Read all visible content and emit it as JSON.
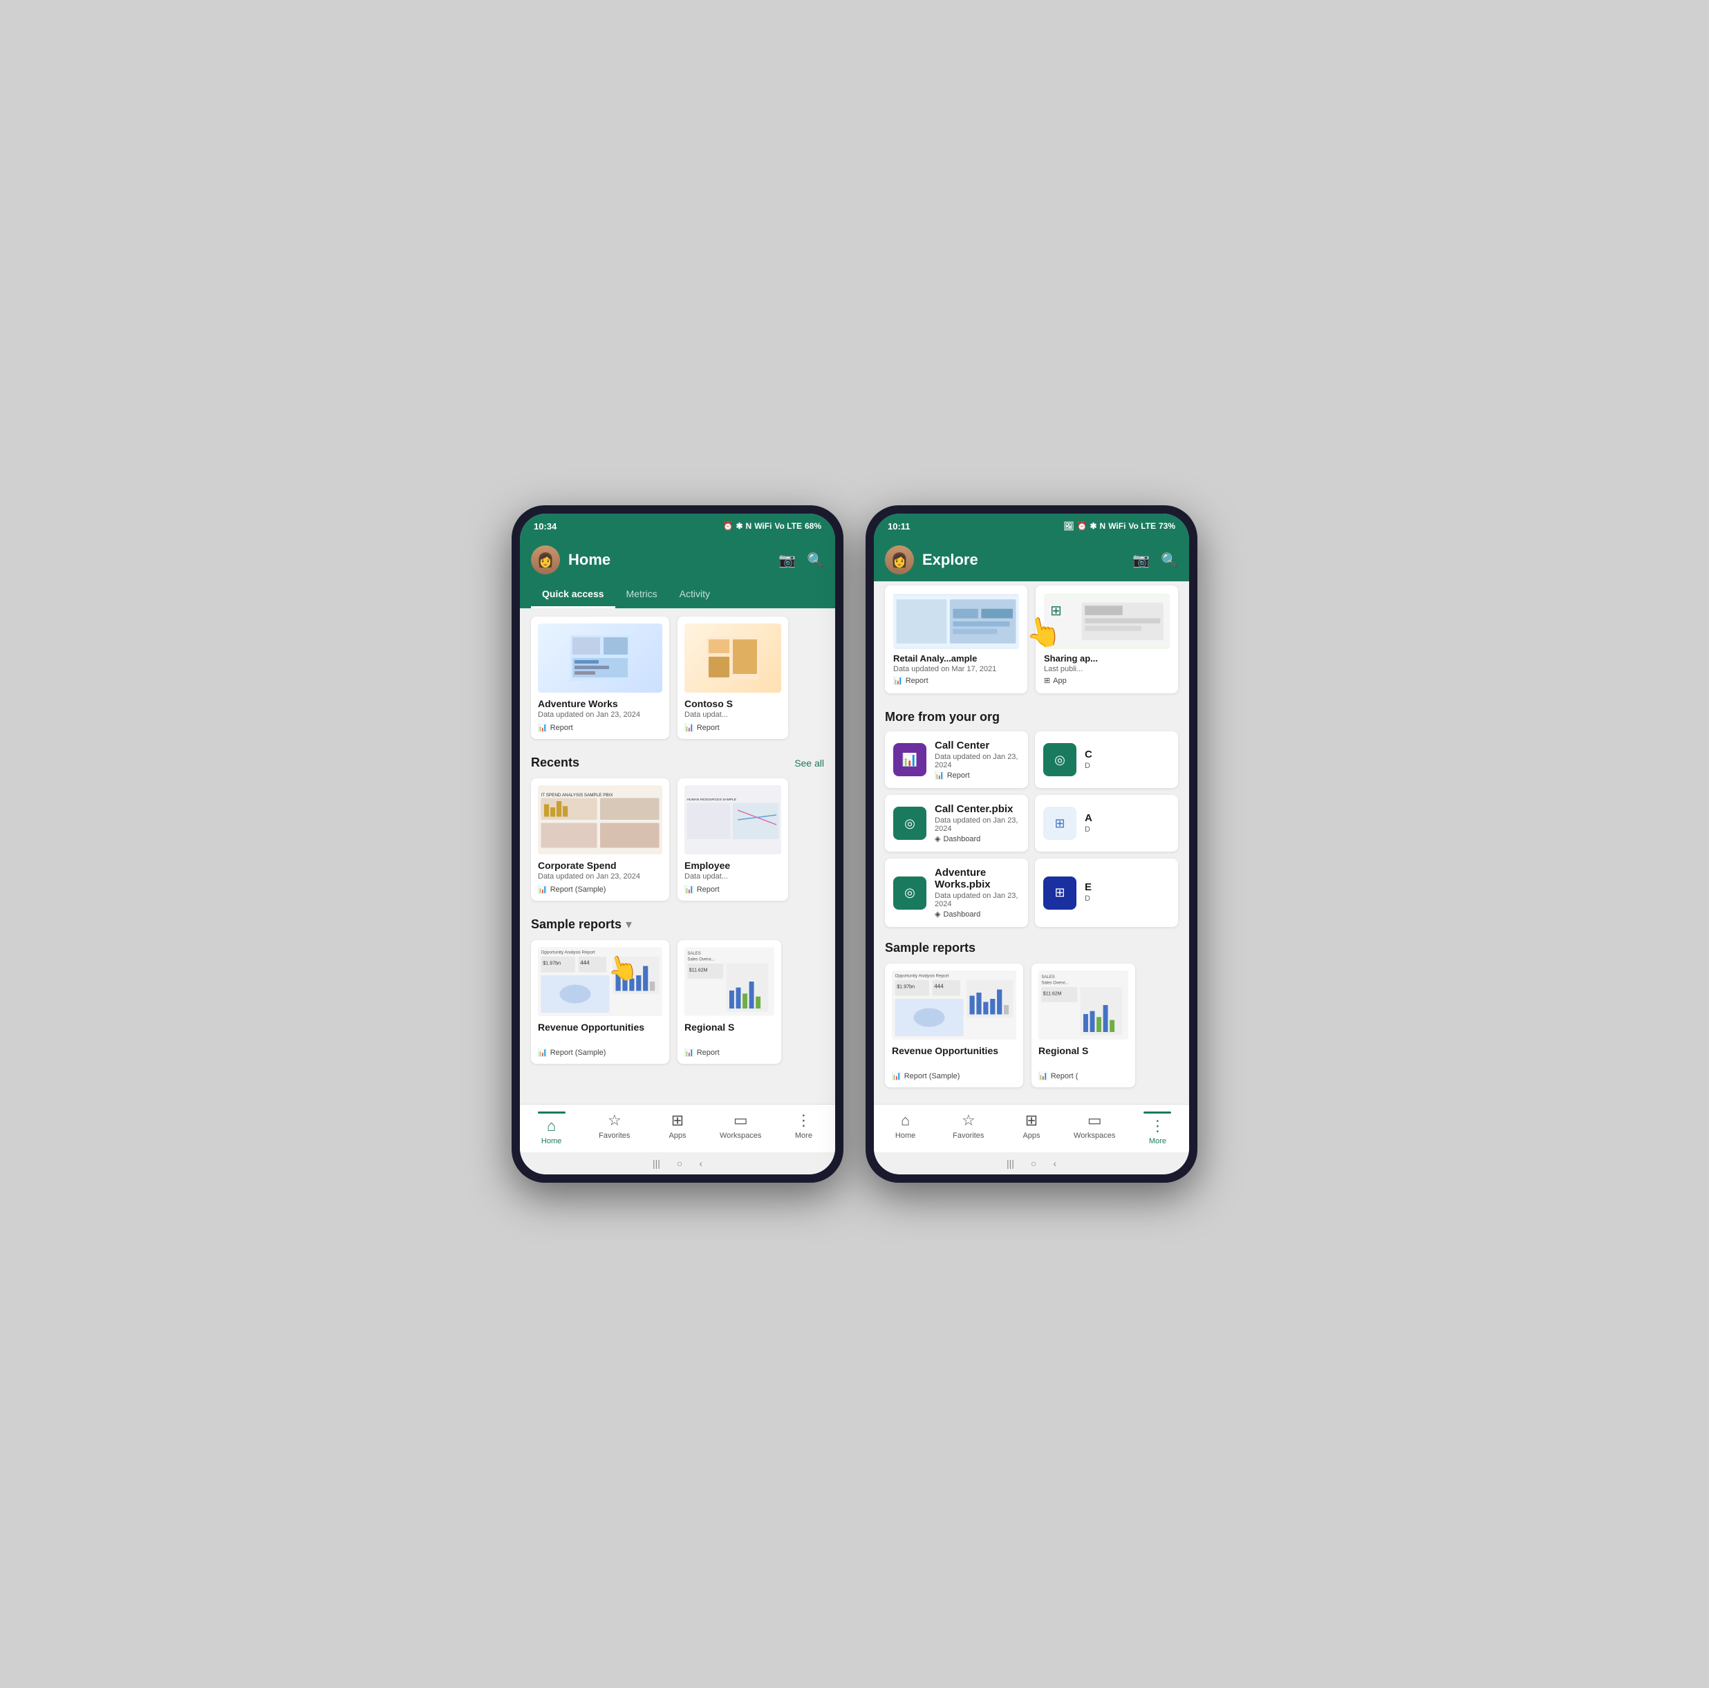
{
  "phone1": {
    "status": {
      "time": "10:34",
      "battery": "68%",
      "signal": "Vo LTE"
    },
    "header": {
      "title": "Home",
      "camera_label": "📷",
      "search_label": "🔍"
    },
    "tabs": [
      {
        "label": "Quick access",
        "active": true
      },
      {
        "label": "Metrics",
        "active": false
      },
      {
        "label": "Activity",
        "active": false
      }
    ],
    "quick_access": [
      {
        "title": "Adventure Works",
        "date": "Data updated on Jan 23, 2024",
        "type": "Report"
      },
      {
        "title": "Contoso S",
        "date": "Data updat...",
        "type": "Report"
      }
    ],
    "recents": {
      "section_title": "Recents",
      "see_all": "See all",
      "items": [
        {
          "title": "Corporate Spend",
          "date": "Data updated on Jan 23, 2024",
          "type": "Report (Sample)"
        },
        {
          "title": "Employee",
          "date": "Data updat...",
          "type": "Report"
        }
      ]
    },
    "sample_reports": {
      "section_title": "Sample reports",
      "items": [
        {
          "title": "Revenue Opportunities",
          "date": "",
          "type": "Report (Sample)"
        },
        {
          "title": "Regional S",
          "date": "",
          "type": "Report"
        }
      ]
    },
    "nav": [
      {
        "label": "Home",
        "icon": "🏠",
        "active": true
      },
      {
        "label": "Favorites",
        "icon": "☆",
        "active": false
      },
      {
        "label": "Apps",
        "icon": "⊞",
        "active": false
      },
      {
        "label": "Workspaces",
        "icon": "▭",
        "active": false
      },
      {
        "label": "More",
        "icon": "⋮",
        "active": false
      }
    ]
  },
  "phone2": {
    "status": {
      "time": "10:11",
      "battery": "73%",
      "signal": "Vo LTE"
    },
    "header": {
      "title": "Explore",
      "camera_label": "📷",
      "search_label": "🔍"
    },
    "top_cards": [
      {
        "title": "Retail Analy...ample",
        "date": "Data updated on Mar 17, 2021",
        "type": "Report"
      },
      {
        "title": "Sharing ap...",
        "date": "Last publi...",
        "type": "App"
      }
    ],
    "more_from_org": {
      "section_title": "More from your org",
      "items": [
        {
          "name": "Call Center",
          "date": "Data updated on Jan 23, 2024",
          "type": "Report",
          "icon_color": "#6b2fa0",
          "icon": "📊"
        },
        {
          "name": "C",
          "date": "D",
          "type": "",
          "icon_color": "#1a7a5e",
          "icon": "◎"
        },
        {
          "name": "Call Center.pbix",
          "date": "Data updated on Jan 23, 2024",
          "type": "Dashboard",
          "icon_color": "#1a7a5e",
          "icon": "◎"
        },
        {
          "name": "A",
          "date": "D",
          "type": "",
          "icon_color": "#e8f0fa",
          "icon": "⊞"
        },
        {
          "name": "Adventure Works.pbix",
          "date": "Data updated on Jan 23, 2024",
          "type": "Dashboard",
          "icon_color": "#1a7a5e",
          "icon": "◎"
        },
        {
          "name": "E",
          "date": "D",
          "type": "",
          "icon_color": "#1a2fa0",
          "icon": "⊞"
        }
      ]
    },
    "sample_reports": {
      "section_title": "Sample reports",
      "items": [
        {
          "title": "Revenue Opportunities",
          "type": "Report (Sample)"
        },
        {
          "title": "Regional S",
          "type": "Report ("
        }
      ]
    },
    "nav": [
      {
        "label": "Home",
        "icon": "🏠",
        "active": false
      },
      {
        "label": "Favorites",
        "icon": "☆",
        "active": false
      },
      {
        "label": "Apps",
        "icon": "⊞",
        "active": false
      },
      {
        "label": "Workspaces",
        "icon": "▭",
        "active": false
      },
      {
        "label": "More",
        "icon": "⋮",
        "active": true
      }
    ]
  }
}
